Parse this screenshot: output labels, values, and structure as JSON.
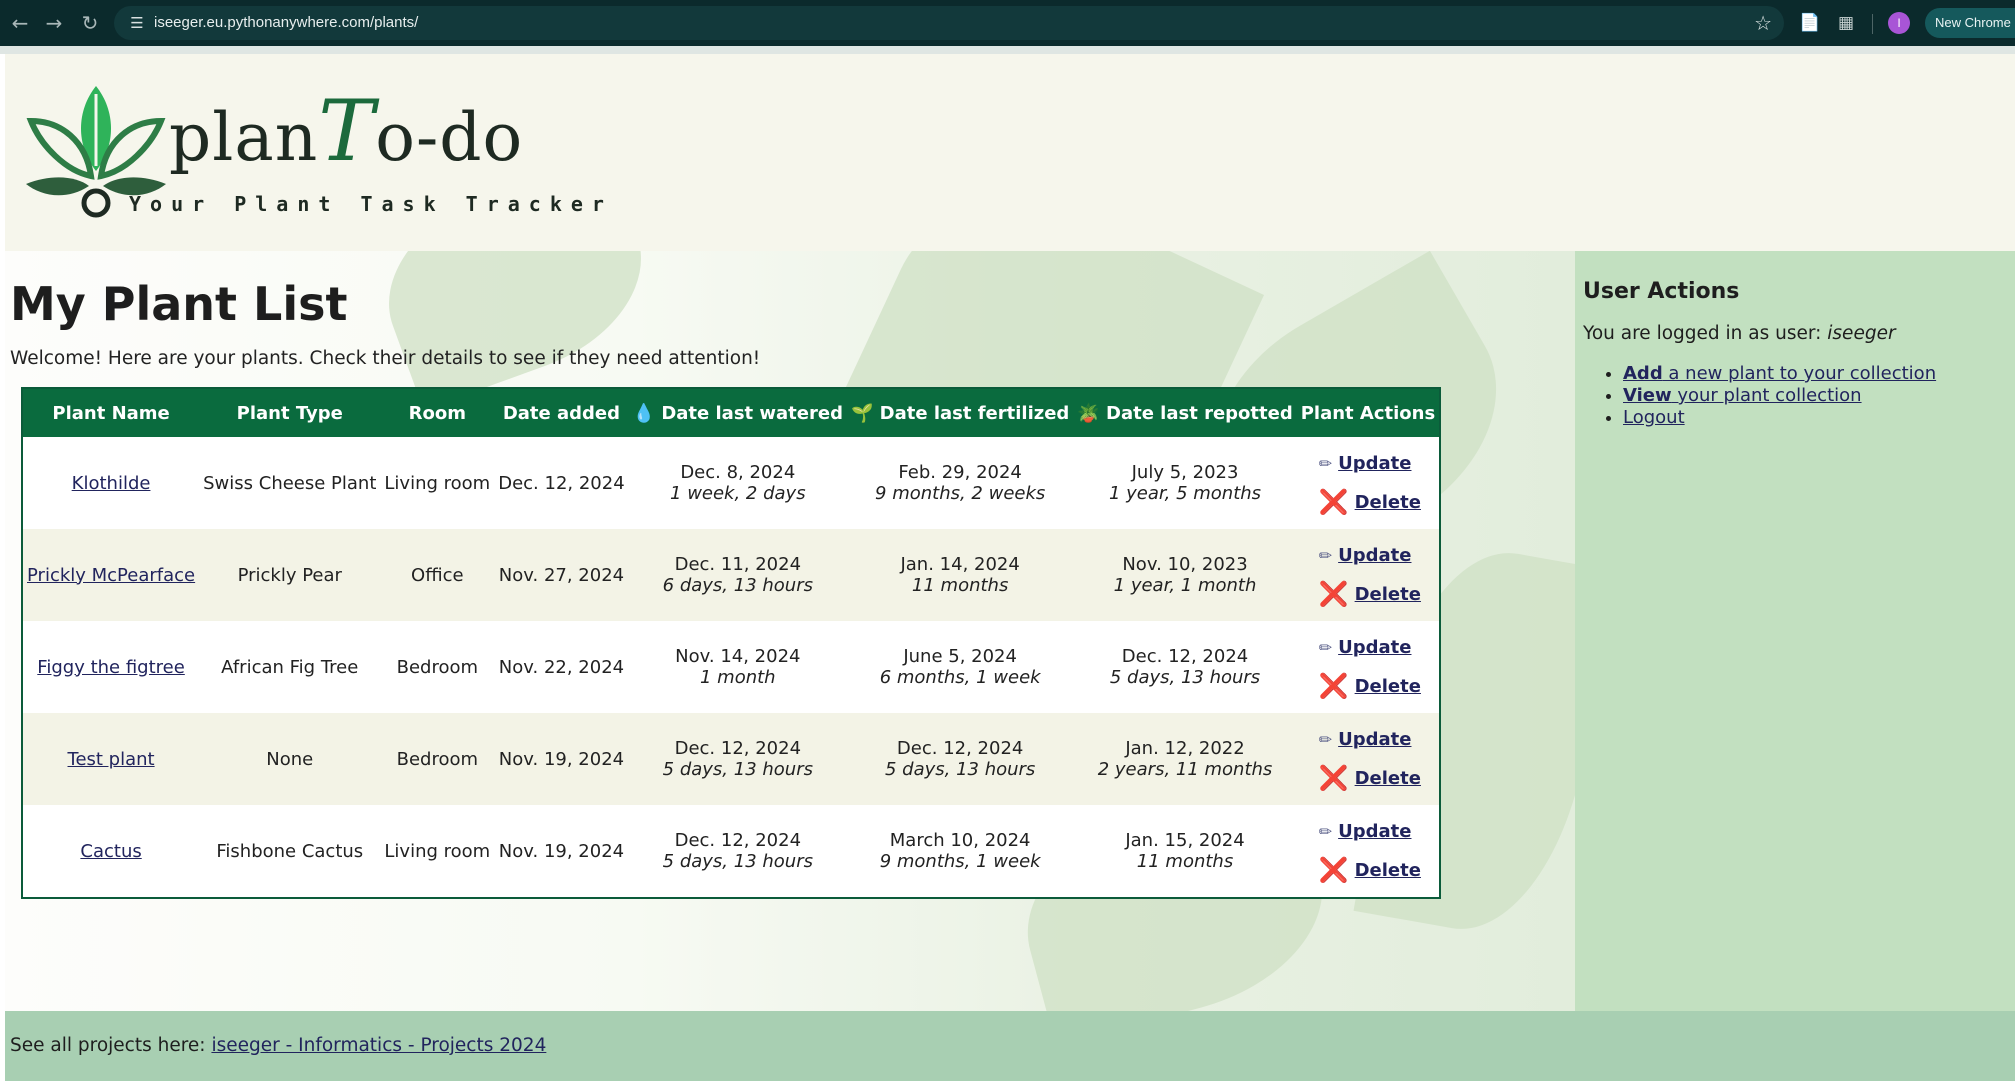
{
  "browser": {
    "url": "iseeger.eu.pythonanywhere.com/plants/",
    "avatar_initial": "I",
    "new_chrome_label": "New Chrome"
  },
  "header": {
    "logo_prefix": "plan",
    "logo_t": "T",
    "logo_suffix": "o-do",
    "tagline": "Your Plant Task Tracker"
  },
  "main": {
    "title": "My Plant List",
    "welcome": "Welcome! Here are your plants. Check their details to see if they need attention!",
    "columns": [
      "Plant Name",
      "Plant Type",
      "Room",
      "Date added",
      "💧 Date last watered",
      "🌱 Date last fertilized",
      "🪴 Date last repotted",
      "Plant Actions"
    ],
    "update_label": "Update",
    "delete_label": "Delete",
    "rows": [
      {
        "name": "Klothilde",
        "type": "Swiss Cheese Plant",
        "room": "Living room",
        "added": "Dec. 12, 2024",
        "watered": "Dec. 8, 2024",
        "watered_ago": "1 week, 2 days",
        "fertilized": "Feb. 29, 2024",
        "fertilized_ago": "9 months, 2 weeks",
        "repotted": "July 5, 2023",
        "repotted_ago": "1 year, 5 months"
      },
      {
        "name": "Prickly McPearface",
        "type": "Prickly Pear",
        "room": "Office",
        "added": "Nov. 27, 2024",
        "watered": "Dec. 11, 2024",
        "watered_ago": "6 days, 13 hours",
        "fertilized": "Jan. 14, 2024",
        "fertilized_ago": "11 months",
        "repotted": "Nov. 10, 2023",
        "repotted_ago": "1 year, 1 month"
      },
      {
        "name": "Figgy the figtree",
        "type": "African Fig Tree",
        "room": "Bedroom",
        "added": "Nov. 22, 2024",
        "watered": "Nov. 14, 2024",
        "watered_ago": "1 month",
        "fertilized": "June 5, 2024",
        "fertilized_ago": "6 months, 1 week",
        "repotted": "Dec. 12, 2024",
        "repotted_ago": "5 days, 13 hours"
      },
      {
        "name": "Test plant",
        "type": "None",
        "room": "Bedroom",
        "added": "Nov. 19, 2024",
        "watered": "Dec. 12, 2024",
        "watered_ago": "5 days, 13 hours",
        "fertilized": "Dec. 12, 2024",
        "fertilized_ago": "5 days, 13 hours",
        "repotted": "Jan. 12, 2022",
        "repotted_ago": "2 years, 11 months"
      },
      {
        "name": "Cactus",
        "type": "Fishbone Cactus",
        "room": "Living room",
        "added": "Nov. 19, 2024",
        "watered": "Dec. 12, 2024",
        "watered_ago": "5 days, 13 hours",
        "fertilized": "March 10, 2024",
        "fertilized_ago": "9 months, 1 week",
        "repotted": "Jan. 15, 2024",
        "repotted_ago": "11 months"
      }
    ]
  },
  "sidebar": {
    "title": "User Actions",
    "logged_in_prefix": "You are logged in as user:",
    "username": "iseeger",
    "links": [
      {
        "bold": "Add",
        "rest": " a new plant to your collection"
      },
      {
        "bold": "View",
        "rest": " your plant collection"
      },
      {
        "bold": "",
        "rest": "Logout"
      }
    ]
  },
  "footer": {
    "prefix": "See all projects here:",
    "link": "iseeger - Informatics - Projects 2024"
  },
  "colors": {
    "table_header": "#0a6b3e",
    "sidebar": "#c2e0c0",
    "footer": "#a8cfb2",
    "header_bg": "#f6f6ec",
    "link": "#21245d",
    "delete_icon": "#d61f1f"
  }
}
